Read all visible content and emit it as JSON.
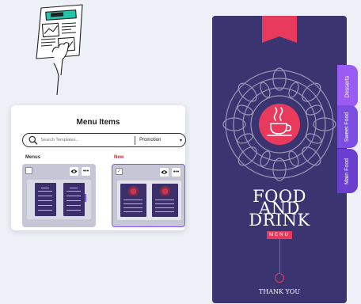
{
  "panel": {
    "title": "Menu Items",
    "search": {
      "placeholder": "Search Templates..."
    },
    "filter": {
      "selected": "Promotion",
      "caret": "▾"
    },
    "sections": {
      "menus_label": "Menus",
      "new_label": "New"
    },
    "cards": [
      {
        "checked": false,
        "check_glyph": ""
      },
      {
        "checked": true,
        "check_glyph": "✓"
      }
    ],
    "more_glyph": "•••"
  },
  "poster": {
    "lines": [
      "FOOD",
      "AND",
      "DRINK"
    ],
    "badge": "MENU",
    "footer": "THANK YOU"
  },
  "side_tabs": {
    "desserts": "Desserts",
    "sweet_food": "Sweet Food",
    "main_food": "Main Food"
  },
  "colors": {
    "poster_bg": "#3a3570",
    "accent_pink": "#e83a5c",
    "accent_purple": "#7a56ff",
    "new_label_red": "#e0203c",
    "illustration_teal": "#22c3a8"
  },
  "icons": [
    "search-icon",
    "eye-icon",
    "more-icon",
    "chevron-down-icon",
    "coffee-cup-icon",
    "check-icon"
  ]
}
